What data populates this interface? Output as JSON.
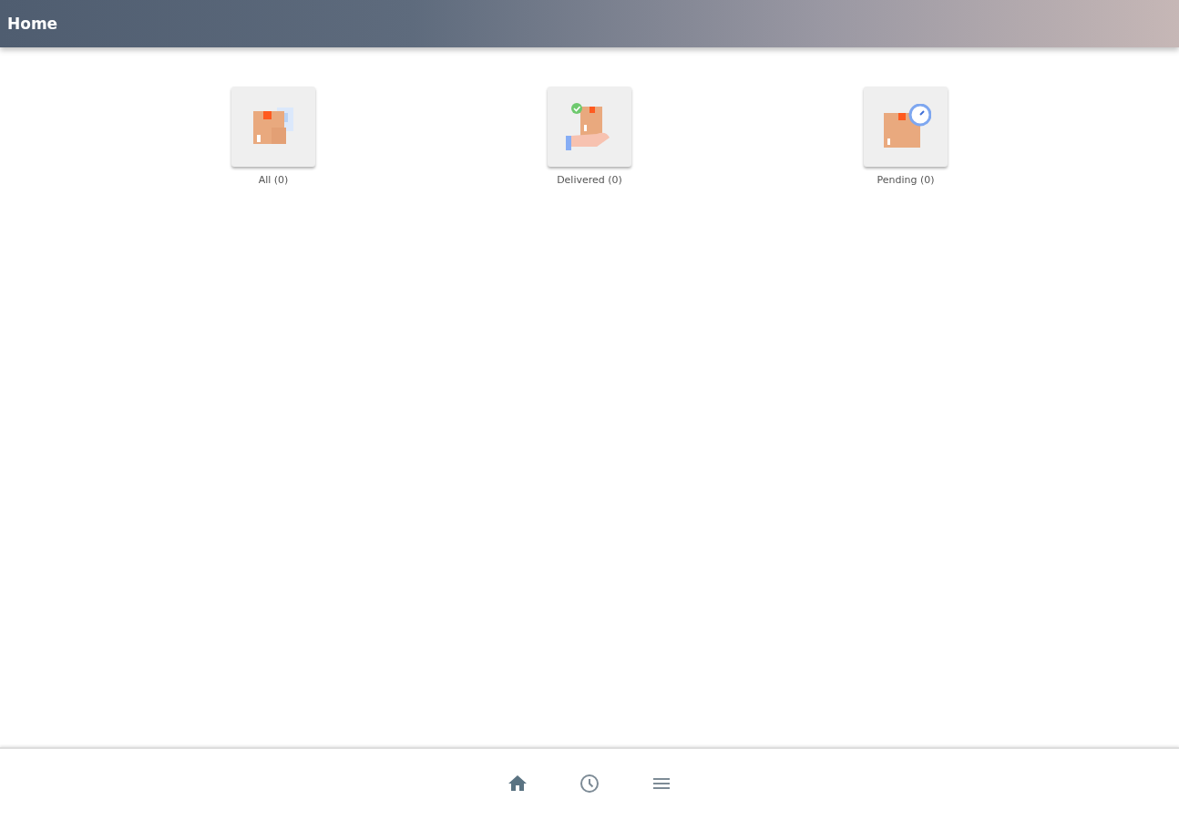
{
  "header": {
    "title": "Home"
  },
  "categories": [
    {
      "kind": "all",
      "label": "All (0)"
    },
    {
      "kind": "delivered",
      "label": "Delivered (0)"
    },
    {
      "kind": "pending",
      "label": "Pending (0)"
    }
  ],
  "bottom_nav": [
    {
      "kind": "home",
      "selected": true
    },
    {
      "kind": "history",
      "selected": false
    },
    {
      "kind": "menu",
      "selected": false
    }
  ]
}
